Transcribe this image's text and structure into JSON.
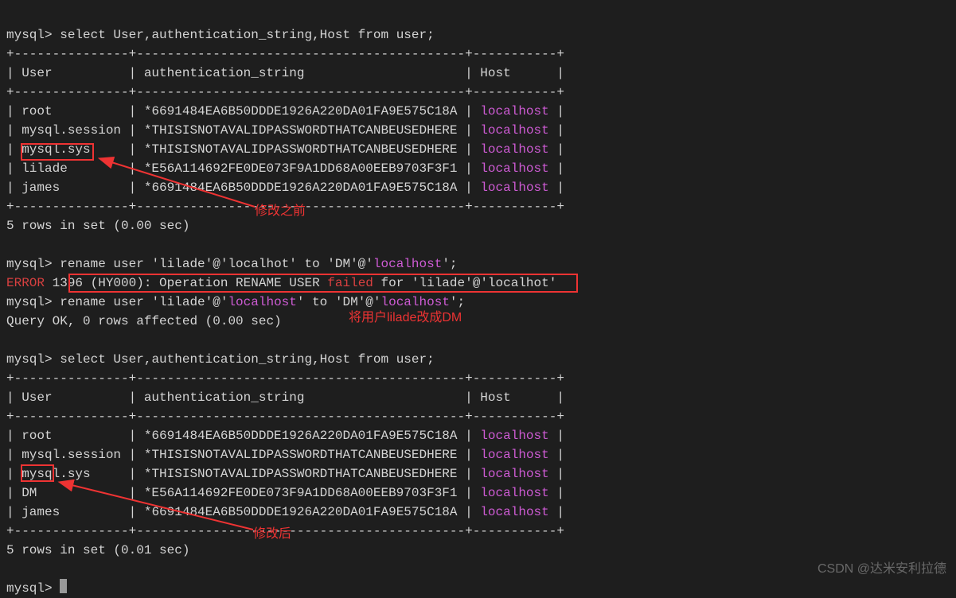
{
  "prompt": "mysql>",
  "query1": {
    "sql": "select User,authentication_string,Host from user;",
    "divider_top": "+---------------+-------------------------------------------+-----------+",
    "header": "| User          | authentication_string                     | Host      |",
    "divider_mid": "+---------------+-------------------------------------------+-----------+",
    "rows": [
      {
        "user": "root",
        "auth": "*6691484EA6B50DDDE1926A220DA01FA9E575C18A",
        "host": "localhost"
      },
      {
        "user": "mysql.session",
        "auth": "*THISISNOTAVALIDPASSWORDTHATCANBEUSEDHERE",
        "host": "localhost"
      },
      {
        "user": "mysql.sys",
        "auth": "*THISISNOTAVALIDPASSWORDTHATCANBEUSEDHERE",
        "host": "localhost"
      },
      {
        "user": "lilade",
        "auth": "*E56A114692FE0DE073F9A1DD68A00EEB9703F3F1",
        "host": "localhost"
      },
      {
        "user": "james",
        "auth": "*6691484EA6B50DDDE1926A220DA01FA9E575C18A",
        "host": "localhost"
      }
    ],
    "divider_bot": "+---------------+-------------------------------------------+-----------+",
    "summary": "5 rows in set (0.00 sec)"
  },
  "rename1": {
    "pre": "rename user 'lilade'@'localhot' to 'DM'@'",
    "kw": "localhost",
    "post": "';"
  },
  "error": {
    "label": "ERROR",
    "mid1": " 1396 (HY000): Operation RENAME USER ",
    "label2": "failed",
    "mid2": " for 'lilade'@'localhot'"
  },
  "rename2": {
    "pre": "rename user 'lilade'@'",
    "kw1": "localhost",
    "mid": "' to 'DM'@'",
    "kw2": "localhost",
    "post": "';"
  },
  "ok": "Query OK, 0 rows affected (0.00 sec)",
  "query2": {
    "sql": "select User,authentication_string,Host from user;",
    "divider_top": "+---------------+-------------------------------------------+-----------+",
    "header": "| User          | authentication_string                     | Host      |",
    "divider_mid": "+---------------+-------------------------------------------+-----------+",
    "rows": [
      {
        "user": "root",
        "auth": "*6691484EA6B50DDDE1926A220DA01FA9E575C18A",
        "host": "localhost"
      },
      {
        "user": "mysql.session",
        "auth": "*THISISNOTAVALIDPASSWORDTHATCANBEUSEDHERE",
        "host": "localhost"
      },
      {
        "user": "mysql.sys",
        "auth": "*THISISNOTAVALIDPASSWORDTHATCANBEUSEDHERE",
        "host": "localhost"
      },
      {
        "user": "DM",
        "auth": "*E56A114692FE0DE073F9A1DD68A00EEB9703F3F1",
        "host": "localhost"
      },
      {
        "user": "james",
        "auth": "*6691484EA6B50DDDE1926A220DA01FA9E575C18A",
        "host": "localhost"
      }
    ],
    "divider_bot": "+---------------+-------------------------------------------+-----------+",
    "summary": "5 rows in set (0.01 sec)"
  },
  "annotations": {
    "before": "修改之前",
    "rename_note": "将用户lilade改成DM",
    "after": "修改后"
  },
  "watermark": "CSDN @达米安利拉德"
}
